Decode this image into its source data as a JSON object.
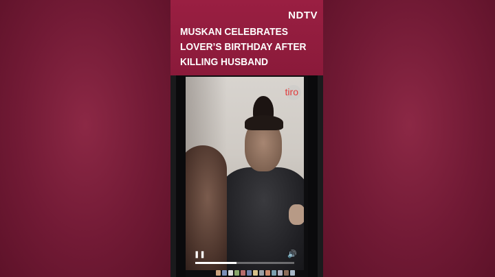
{
  "brand": {
    "logo": "NDTV"
  },
  "headline": {
    "lines": [
      "MUSKAN CELEBRATES",
      "LOVER’S BIRTHDAY AFTER",
      "KILLING HUSBAND"
    ]
  },
  "video": {
    "watermark": "tiro",
    "play_icon": "pause-icon",
    "volume_icon": "volume-icon",
    "progress": 0.42
  },
  "colors": {
    "header": "#9a1f42",
    "background": "#7a1e3a",
    "watermark": "#e23a3a"
  }
}
